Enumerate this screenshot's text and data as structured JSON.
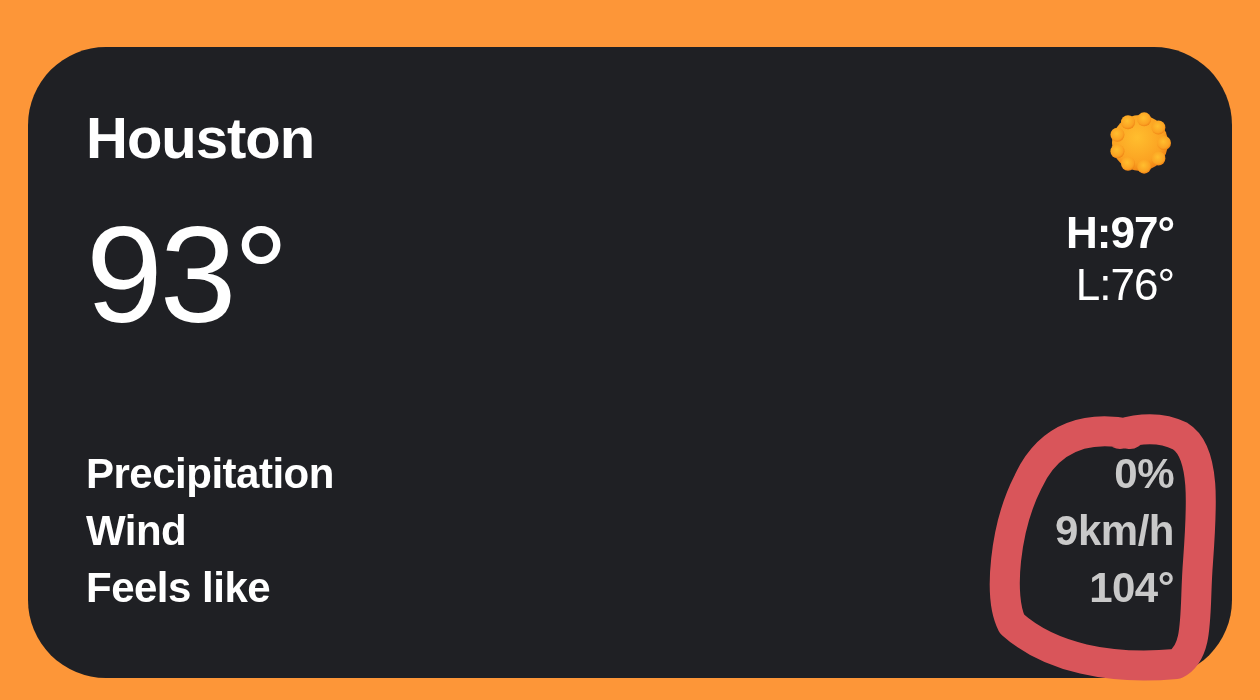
{
  "location": "Houston",
  "temperature": "93°",
  "high": "H:97°",
  "low": "L:76°",
  "details": [
    {
      "label": "Precipitation",
      "value": "0%"
    },
    {
      "label": "Wind",
      "value": "9km/h"
    },
    {
      "label": "Feels like",
      "value": "104°"
    }
  ]
}
